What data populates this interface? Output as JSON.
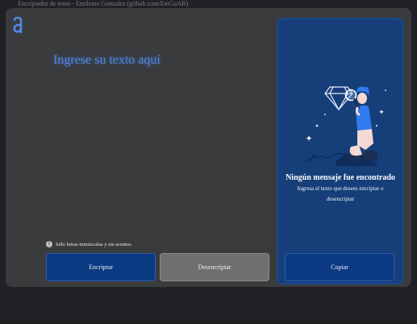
{
  "window": {
    "title": "Encriptador de texto - Emiliano Gonzalez (github.com/EmGoAR)"
  },
  "logo": {
    "icon": "alura-a-icon",
    "color": "#4e88e6"
  },
  "editor": {
    "placeholder": "Ingrese su texto aquí",
    "value": ""
  },
  "hint": {
    "icon": "info-icon",
    "text": "Sólo letras minúsculas y sin acentos"
  },
  "buttons": {
    "encrypt_label": "Encriptar",
    "decrypt_label": "Desencriptar",
    "copy_label": "Copiar"
  },
  "output": {
    "illustration": "person-magnifier-diamond-illustration",
    "title": "Ningún mensaje fue encontrado",
    "body": "Ingresa el texto que desees encriptar o desencriptar"
  },
  "colors": {
    "accent": "#0b3a82",
    "panel": "#163f7a",
    "app_background": "#3a3b3c",
    "placeholder": "#4e88e6"
  }
}
